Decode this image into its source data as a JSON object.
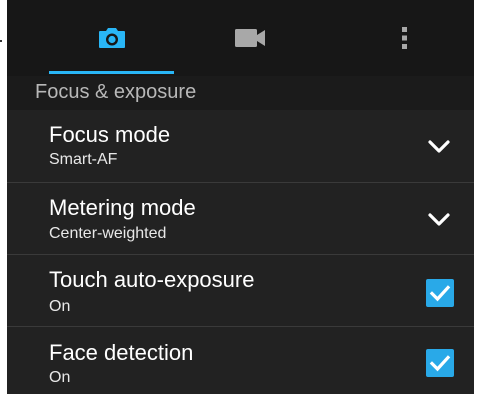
{
  "tabs": [
    {
      "icon": "camera-icon",
      "active": true
    },
    {
      "icon": "video-camera-icon",
      "active": false
    },
    {
      "icon": "more-vert-icon",
      "active": false
    }
  ],
  "colors": {
    "accent": "#29b6f6",
    "checkbox": "#29a9e8",
    "background": "#000000",
    "row_background": "#222222"
  },
  "section": {
    "title": "Focus & exposure"
  },
  "settings": [
    {
      "title": "Focus mode",
      "value": "Smart-AF",
      "control": "dropdown",
      "icon": "chevron-down-icon"
    },
    {
      "title": "Metering mode",
      "value": "Center-weighted",
      "control": "dropdown",
      "icon": "chevron-down-icon"
    },
    {
      "title": "Touch auto-exposure",
      "value": "On",
      "control": "checkbox",
      "checked": true
    },
    {
      "title": "Face detection",
      "value": "On",
      "control": "checkbox",
      "checked": true
    }
  ]
}
